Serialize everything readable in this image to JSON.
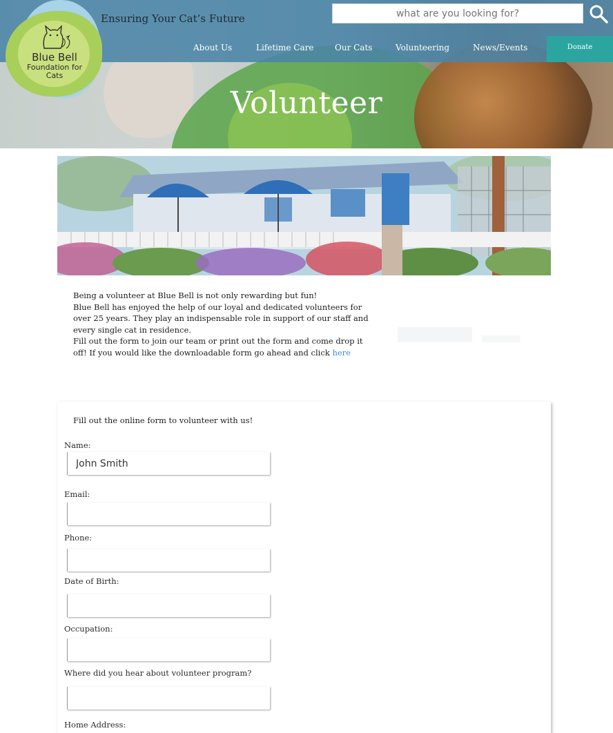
{
  "header": {
    "tagline": "Ensuring Your Cat’s Future",
    "logo": {
      "line1": "Blue Bell",
      "line2": "Foundation for",
      "line3": "Cats"
    },
    "search": {
      "placeholder": "what are you looking for?",
      "icon": "search-icon"
    },
    "nav": [
      "About Us",
      "Lifetime Care",
      "Our Cats",
      "Volunteering",
      "News/Events"
    ],
    "donate_label": "Donate"
  },
  "hero": {
    "title": "Volunteer"
  },
  "intro": {
    "p1": "Being a volunteer at Blue Bell is not only rewarding but fun!",
    "p2": "Blue Bell has enjoyed the help of our loyal and dedicated volunteers for over 25 years. They play an indispensable role in support of our staff and every single cat in residence.",
    "p3_prefix": "Fill out the form to join our team or print out the form and come drop it off! If you would like the downloadable form go ahead and click ",
    "p3_link": "here"
  },
  "form": {
    "heading": "Fill out the online form to volunteer with us!",
    "fields": [
      {
        "label": "Name:",
        "value": "John Smith"
      },
      {
        "label": "Email:",
        "value": ""
      },
      {
        "label": "Phone:",
        "value": ""
      },
      {
        "label": "Date of Birth:",
        "value": ""
      },
      {
        "label": "Occupation:",
        "value": ""
      },
      {
        "label": "Where did you hear about volunteer program?",
        "value": ""
      },
      {
        "label": "Home Address:",
        "value": ""
      }
    ]
  },
  "colors": {
    "topbar": "#4a84a7",
    "donate": "#2ca5a1",
    "link": "#3b8fd0",
    "logo_green": "#a8cf5a",
    "logo_blue": "#a8d3e8"
  }
}
